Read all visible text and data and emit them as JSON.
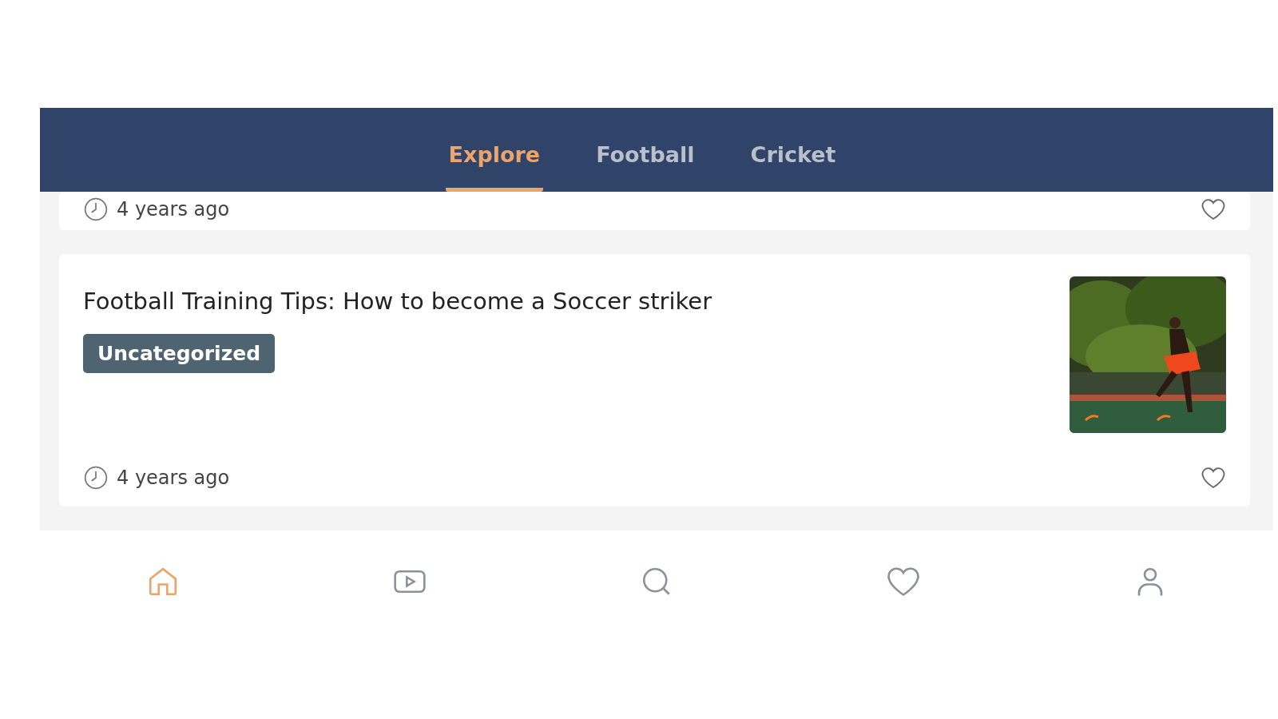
{
  "tabs": [
    {
      "label": "Explore",
      "selected": true
    },
    {
      "label": "Football",
      "selected": false
    },
    {
      "label": "Cricket",
      "selected": false
    }
  ],
  "posts": [
    {
      "kind": "partial",
      "time": "4 years ago",
      "liked": false
    },
    {
      "kind": "full",
      "title": "Football Training Tips: How to become a Soccer striker",
      "category": "Uncategorized",
      "time": "4 years ago",
      "liked": false
    }
  ],
  "bottom_nav": [
    {
      "kind": "home",
      "selected": true
    },
    {
      "kind": "video",
      "selected": false
    },
    {
      "kind": "search",
      "selected": false
    },
    {
      "kind": "favorites",
      "selected": false
    },
    {
      "kind": "profile",
      "selected": false
    }
  ]
}
